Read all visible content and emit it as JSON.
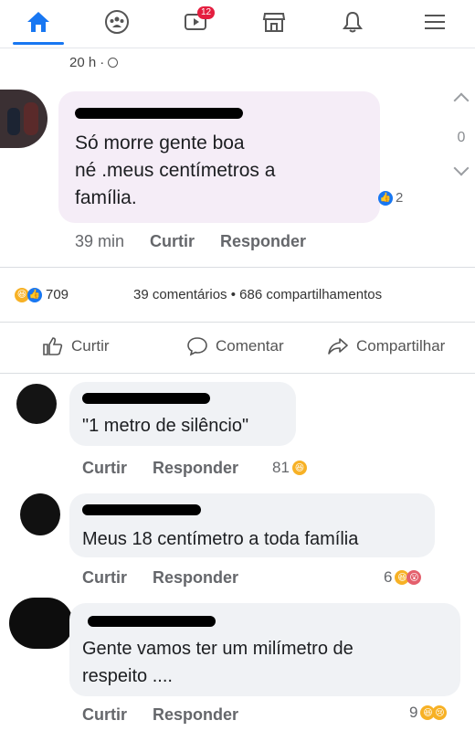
{
  "nav": {
    "notifications_badge": "12"
  },
  "post_meta": {
    "time": "20 h",
    "separator": "·"
  },
  "main_comment": {
    "text_line1": "Só morre gente boa",
    "text_line2": "né .meus centímetros a",
    "text_line3": "família.",
    "reaction_count": "2",
    "time": "39 min",
    "like_label": "Curtir",
    "reply_label": "Responder",
    "side_count": "0"
  },
  "stats": {
    "reaction_count": "709",
    "comments": "39 comentários",
    "dot": "•",
    "shares": "686 compartilhamentos"
  },
  "action_bar": {
    "like": "Curtir",
    "comment": "Comentar",
    "share": "Compartilhar"
  },
  "comments": [
    {
      "text": "\"1 metro de silêncio\"",
      "like": "Curtir",
      "reply": "Responder",
      "reactions": "81"
    },
    {
      "text": "Meus 18 centímetro a toda família",
      "like": "Curtir",
      "reply": "Responder",
      "reactions": "6"
    },
    {
      "text_line1": "Gente vamos ter um milímetro de",
      "text_line2": "respeito ....",
      "like": "Curtir",
      "reply": "Responder",
      "reactions": "9"
    }
  ]
}
